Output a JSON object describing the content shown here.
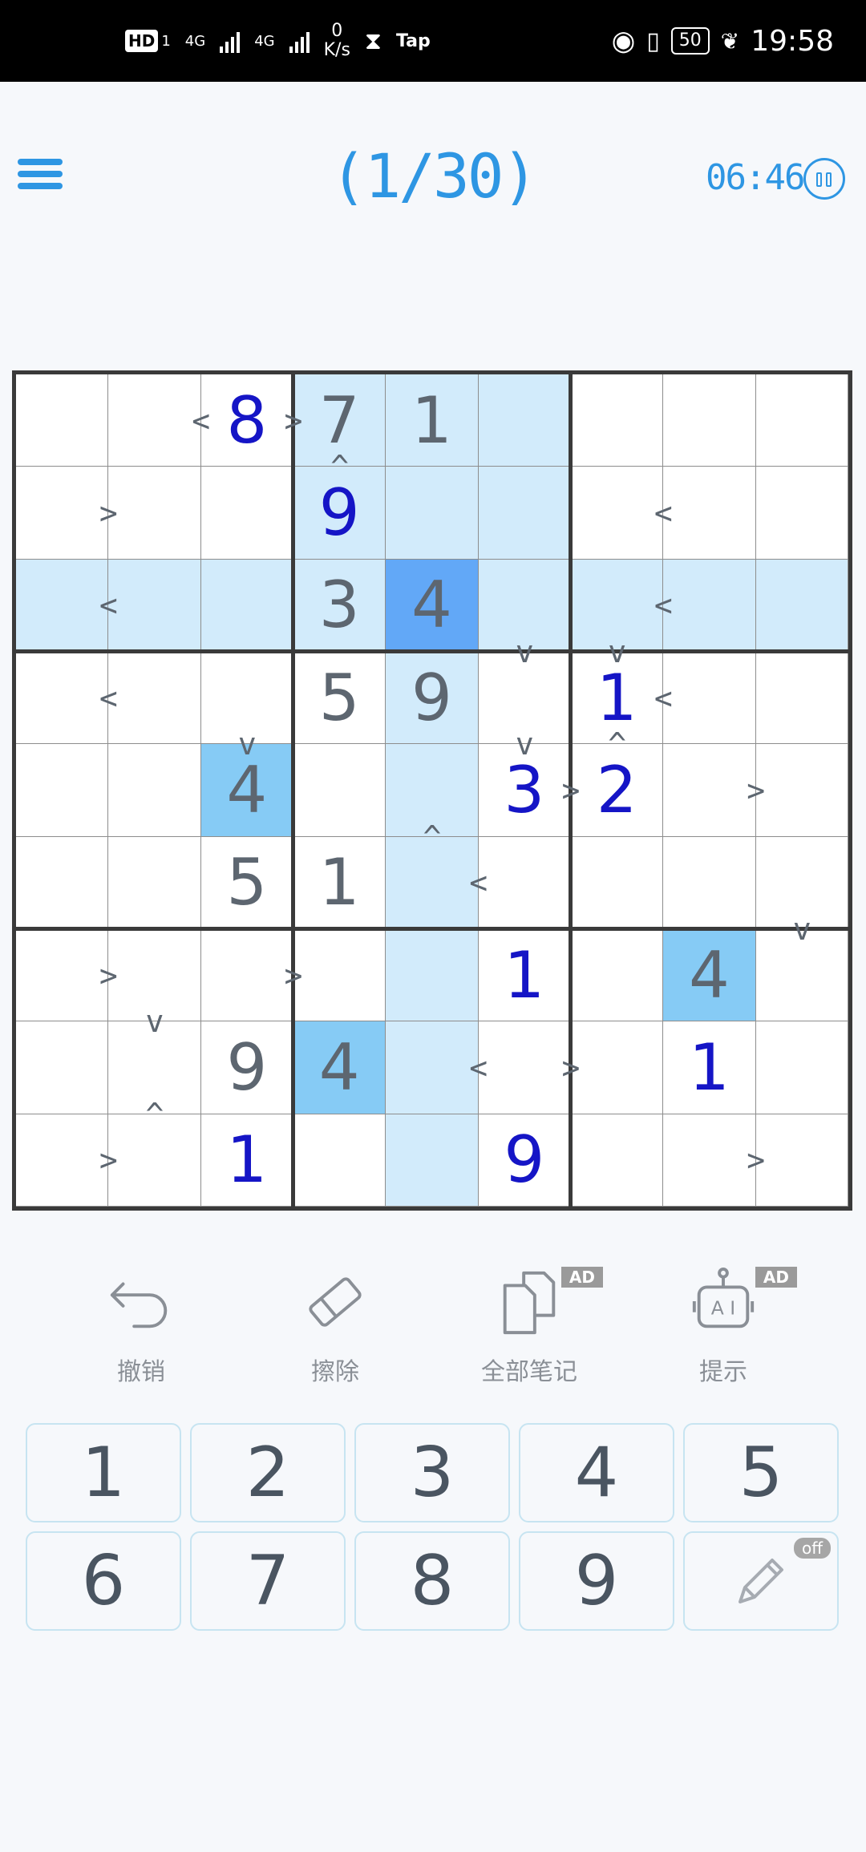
{
  "status_bar": {
    "hd": "HD",
    "sim": "1",
    "net1": "4G",
    "net2": "4G",
    "speed_value": "0",
    "speed_unit": "K/s",
    "tap": "Tap",
    "battery": "50",
    "time": "19:58"
  },
  "header": {
    "level": "(1/30)",
    "timer": "06:46"
  },
  "board": {
    "cells": [
      [
        "",
        "",
        "8",
        "7",
        "1",
        "",
        "",
        "",
        ""
      ],
      [
        "",
        "",
        "",
        "9",
        "",
        "",
        "",
        "",
        ""
      ],
      [
        "",
        "",
        "",
        "3",
        "4",
        "",
        "",
        "",
        ""
      ],
      [
        "",
        "",
        "",
        "5",
        "9",
        "",
        "1",
        "",
        ""
      ],
      [
        "",
        "",
        "4",
        "",
        "",
        "3",
        "2",
        "",
        ""
      ],
      [
        "",
        "",
        "5",
        "1",
        "",
        "",
        "",
        "",
        ""
      ],
      [
        "",
        "",
        "",
        "",
        "",
        "1",
        "",
        "4",
        ""
      ],
      [
        "",
        "",
        "9",
        "4",
        "",
        "",
        "",
        "1",
        ""
      ],
      [
        "",
        "",
        "1",
        "",
        "",
        "9",
        "",
        "",
        ""
      ]
    ],
    "given": [
      [
        0,
        3
      ],
      [
        0,
        4
      ],
      [
        2,
        3
      ],
      [
        2,
        4
      ],
      [
        3,
        3
      ],
      [
        3,
        4
      ],
      [
        4,
        2
      ],
      [
        5,
        2
      ],
      [
        5,
        3
      ],
      [
        6,
        7
      ],
      [
        7,
        2
      ],
      [
        7,
        3
      ]
    ],
    "selected": [
      2,
      4
    ],
    "same_value": [
      [
        4,
        2
      ],
      [
        6,
        7
      ],
      [
        7,
        3
      ]
    ],
    "highlighted_rows": [
      2
    ],
    "highlighted_cols": [
      4
    ],
    "highlighted_boxes": [
      [
        0,
        1
      ]
    ],
    "h_ineq": [
      {
        "r": 0,
        "c": 1,
        "s": "<"
      },
      {
        "r": 0,
        "c": 2,
        "s": ">"
      },
      {
        "r": 1,
        "c": 0,
        "s": ">"
      },
      {
        "r": 1,
        "c": 6,
        "s": "<"
      },
      {
        "r": 2,
        "c": 0,
        "s": "<"
      },
      {
        "r": 2,
        "c": 6,
        "s": "<"
      },
      {
        "r": 3,
        "c": 0,
        "s": "<"
      },
      {
        "r": 3,
        "c": 6,
        "s": "<"
      },
      {
        "r": 4,
        "c": 5,
        "s": ">"
      },
      {
        "r": 4,
        "c": 7,
        "s": ">"
      },
      {
        "r": 5,
        "c": 4,
        "s": "<"
      },
      {
        "r": 6,
        "c": 0,
        "s": ">"
      },
      {
        "r": 6,
        "c": 2,
        "s": ">"
      },
      {
        "r": 7,
        "c": 4,
        "s": "<"
      },
      {
        "r": 7,
        "c": 5,
        "s": ">"
      },
      {
        "r": 8,
        "c": 0,
        "s": ">"
      },
      {
        "r": 8,
        "c": 7,
        "s": ">"
      }
    ],
    "v_ineq": [
      {
        "r": 0,
        "c": 3,
        "s": "^"
      },
      {
        "r": 2,
        "c": 5,
        "s": "v"
      },
      {
        "r": 2,
        "c": 6,
        "s": "v"
      },
      {
        "r": 3,
        "c": 2,
        "s": "v"
      },
      {
        "r": 3,
        "c": 5,
        "s": "v"
      },
      {
        "r": 3,
        "c": 6,
        "s": "^"
      },
      {
        "r": 4,
        "c": 4,
        "s": "^"
      },
      {
        "r": 5,
        "c": 8,
        "s": "v"
      },
      {
        "r": 6,
        "c": 1,
        "s": "v"
      },
      {
        "r": 7,
        "c": 1,
        "s": "^"
      }
    ]
  },
  "tools": [
    {
      "label": "撤销",
      "icon": "undo-icon",
      "ad": ""
    },
    {
      "label": "擦除",
      "icon": "eraser-icon",
      "ad": ""
    },
    {
      "label": "全部笔记",
      "icon": "notes-icon",
      "ad": "AD"
    },
    {
      "label": "提示",
      "icon": "hint-robot-icon",
      "ad": "AD"
    }
  ],
  "numpad": [
    "1",
    "2",
    "3",
    "4",
    "5",
    "6",
    "7",
    "8",
    "9"
  ],
  "notes_toggle": {
    "state": "off",
    "icon": "pencil-icon"
  },
  "colors": {
    "accent": "#2e96e3",
    "entered": "#1515c6",
    "given": "#5d6670",
    "highlight": "#d2ebfb",
    "same_value": "#86cbf5",
    "selected": "#62a8f7"
  }
}
